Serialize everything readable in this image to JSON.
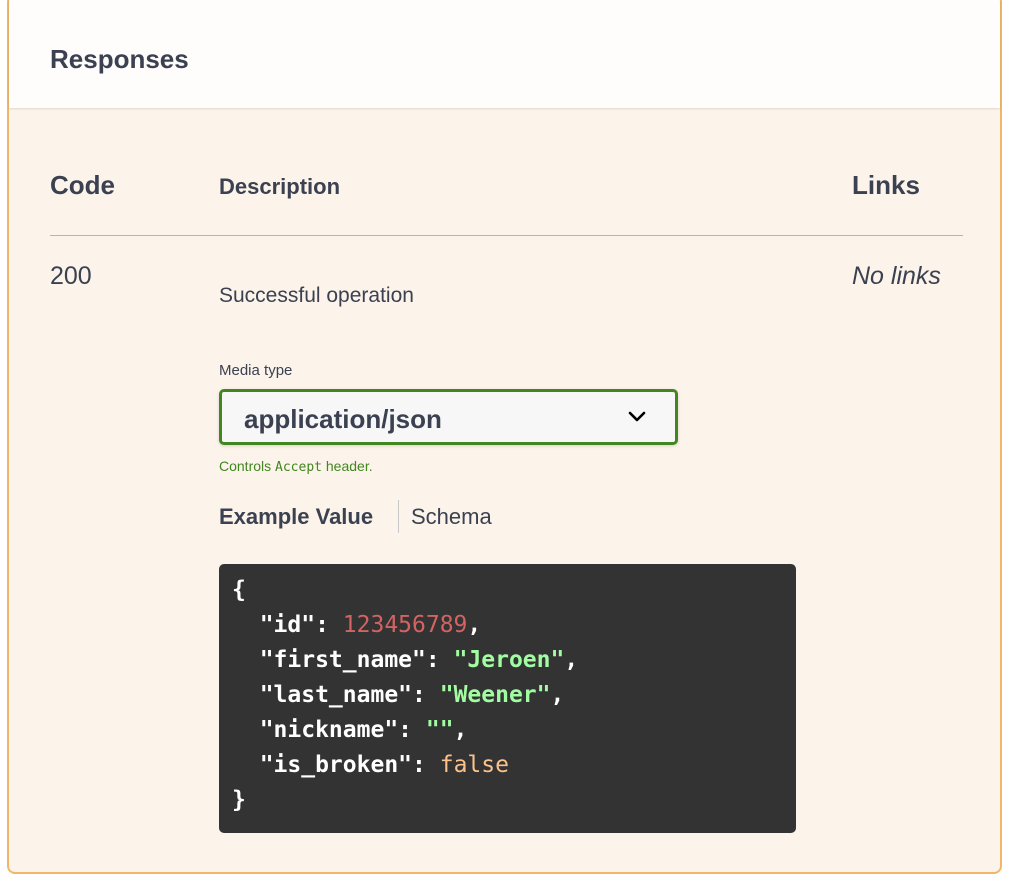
{
  "section": {
    "title": "Responses"
  },
  "table": {
    "headers": {
      "code": "Code",
      "description": "Description",
      "links": "Links"
    },
    "row": {
      "code": "200",
      "description": "Successful operation",
      "links": "No links"
    }
  },
  "media": {
    "label": "Media type",
    "selected": "application/json",
    "note_prefix": "Controls ",
    "note_code": "Accept",
    "note_suffix": " header."
  },
  "tabs": {
    "example": "Example Value",
    "schema": "Schema"
  },
  "example": {
    "open": "{",
    "close": "}",
    "fields": [
      {
        "key": "\"id\"",
        "value": "123456789",
        "type": "number",
        "trail": ","
      },
      {
        "key": "\"first_name\"",
        "value": "\"Jeroen\"",
        "type": "string",
        "trail": ","
      },
      {
        "key": "\"last_name\"",
        "value": "\"Weener\"",
        "type": "string",
        "trail": ","
      },
      {
        "key": "\"nickname\"",
        "value": "\"\"",
        "type": "string",
        "trail": ","
      },
      {
        "key": "\"is_broken\"",
        "value": "false",
        "type": "boolean",
        "trail": ""
      }
    ]
  },
  "colors": {
    "panel_bg": "#fcf4ea",
    "panel_border": "#f0b66a",
    "select_border": "#41861f",
    "code_bg": "#333333",
    "number": "#d36363",
    "string": "#a2fca2",
    "boolean": "#fcc28c"
  },
  "icons": {
    "select": "chevron-down-icon"
  }
}
